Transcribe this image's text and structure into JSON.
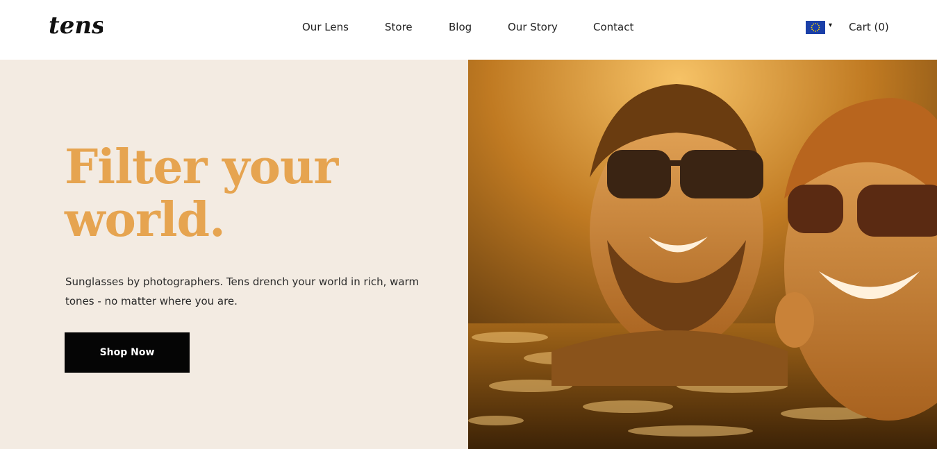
{
  "header": {
    "logo_text": "tens",
    "nav": [
      {
        "label": "Our Lens"
      },
      {
        "label": "Store"
      },
      {
        "label": "Blog"
      },
      {
        "label": "Our Story"
      },
      {
        "label": "Contact"
      }
    ],
    "region": {
      "icon": "eu-flag-icon",
      "caret": "▾"
    },
    "cart_label": "Cart (0)"
  },
  "hero": {
    "title_line1": "Filter your",
    "title_line2": "world.",
    "subtitle": "Sunglasses by photographers. Tens drench your world in rich, warm tones - no matter where you are.",
    "cta_label": "Shop Now",
    "image_icon": "hero-photo-couple-sunglasses-water"
  },
  "colors": {
    "accent": "#e6a450",
    "hero_bg": "#f3ebe2",
    "button_bg": "#050505",
    "button_text": "#ffffff",
    "flag_blue": "#1a3fa8",
    "flag_star": "#f5d300"
  }
}
